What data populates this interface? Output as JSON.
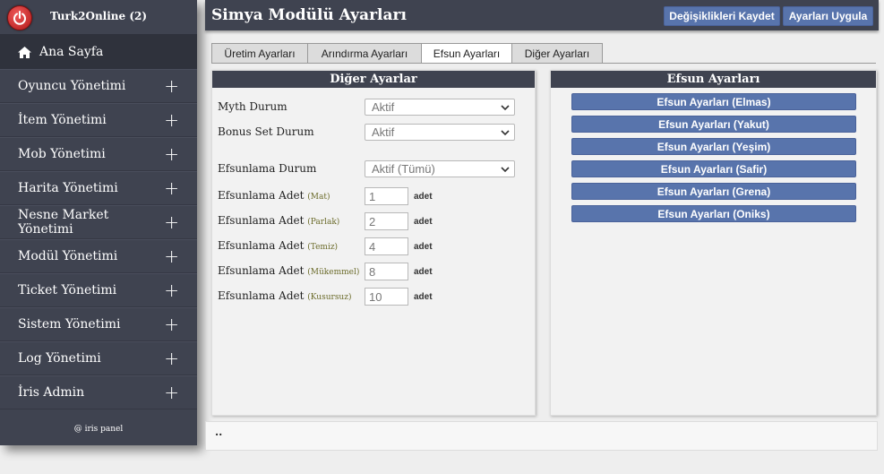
{
  "sidebar": {
    "title": "Turk2Online (2)",
    "home_label": "Ana Sayfa",
    "items": [
      {
        "label": "Oyuncu Yönetimi"
      },
      {
        "label": "İtem Yönetimi"
      },
      {
        "label": "Mob Yönetimi"
      },
      {
        "label": "Harita Yönetimi"
      },
      {
        "label": "Nesne Market Yönetimi"
      },
      {
        "label": "Modül Yönetimi"
      },
      {
        "label": "Ticket Yönetimi"
      },
      {
        "label": "Sistem Yönetimi"
      },
      {
        "label": "Log Yönetimi"
      },
      {
        "label": "İris Admin"
      }
    ],
    "expand_glyph": "+",
    "footer": "@ iris panel"
  },
  "header": {
    "title": "Simya Modülü Ayarları",
    "save_label": "Değişiklikleri Kaydet",
    "apply_label": "Ayarları Uygula"
  },
  "tabs": [
    {
      "label": "Üretim Ayarları"
    },
    {
      "label": "Arındırma Ayarları"
    },
    {
      "label": "Efsun Ayarları"
    },
    {
      "label": "Diğer Ayarları"
    }
  ],
  "left_panel": {
    "title": "Diğer Ayarlar",
    "myth": {
      "label": "Myth Durum",
      "value": "Aktif"
    },
    "bonus": {
      "label": "Bonus Set Durum",
      "value": "Aktif"
    },
    "efsun_durum": {
      "label": "Efsunlama Durum",
      "value": "Aktif (Tümü)"
    },
    "counts": [
      {
        "label": "Efsunlama Adet",
        "grade": "(Mat)",
        "value": "1",
        "unit": "adet"
      },
      {
        "label": "Efsunlama Adet",
        "grade": "(Parlak)",
        "value": "2",
        "unit": "adet"
      },
      {
        "label": "Efsunlama Adet",
        "grade": "(Temiz)",
        "value": "4",
        "unit": "adet"
      },
      {
        "label": "Efsunlama Adet",
        "grade": "(Mükemmel)",
        "value": "8",
        "unit": "adet"
      },
      {
        "label": "Efsunlama Adet",
        "grade": "(Kusursuz)",
        "value": "10",
        "unit": "adet"
      }
    ]
  },
  "right_panel": {
    "title": "Efsun Ayarları",
    "buttons": [
      {
        "label": "Efsun Ayarları (Elmas)"
      },
      {
        "label": "Efsun Ayarları (Yakut)"
      },
      {
        "label": "Efsun Ayarları (Yeşim)"
      },
      {
        "label": "Efsun Ayarları (Safir)"
      },
      {
        "label": "Efsun Ayarları (Grena)"
      },
      {
        "label": "Efsun Ayarları (Oniks)"
      }
    ]
  },
  "bottom": {
    "text": ".."
  },
  "colors": {
    "sidebar_bg": "#3f4350",
    "button_blue": "#5874ac",
    "power_red": "#c62020"
  },
  "icons": [
    "power-icon",
    "home-icon",
    "plus-icon",
    "chevron-down-icon"
  ]
}
